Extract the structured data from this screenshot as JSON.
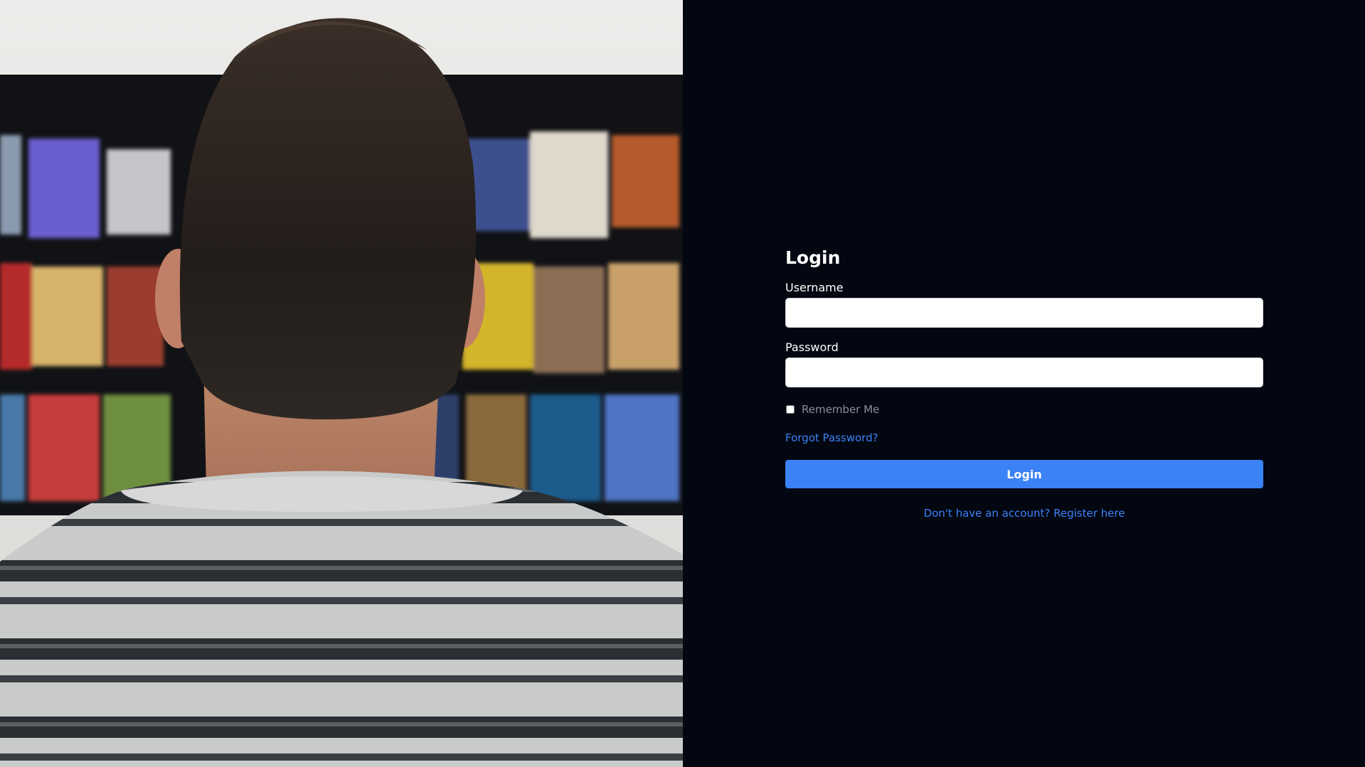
{
  "login": {
    "title": "Login",
    "username_label": "Username",
    "username_value": "",
    "password_label": "Password",
    "password_value": "",
    "remember_label": "Remember Me",
    "remember_checked": false,
    "forgot_link": "Forgot Password?",
    "submit_label": "Login",
    "register_link": "Don't have an account? Register here"
  },
  "colors": {
    "page_background": "#030712",
    "accent": "#3b82f6",
    "label_text": "#ffffff",
    "muted_text": "#8a8f98"
  },
  "hero": {
    "icon": "person-watching-tv-photo"
  }
}
